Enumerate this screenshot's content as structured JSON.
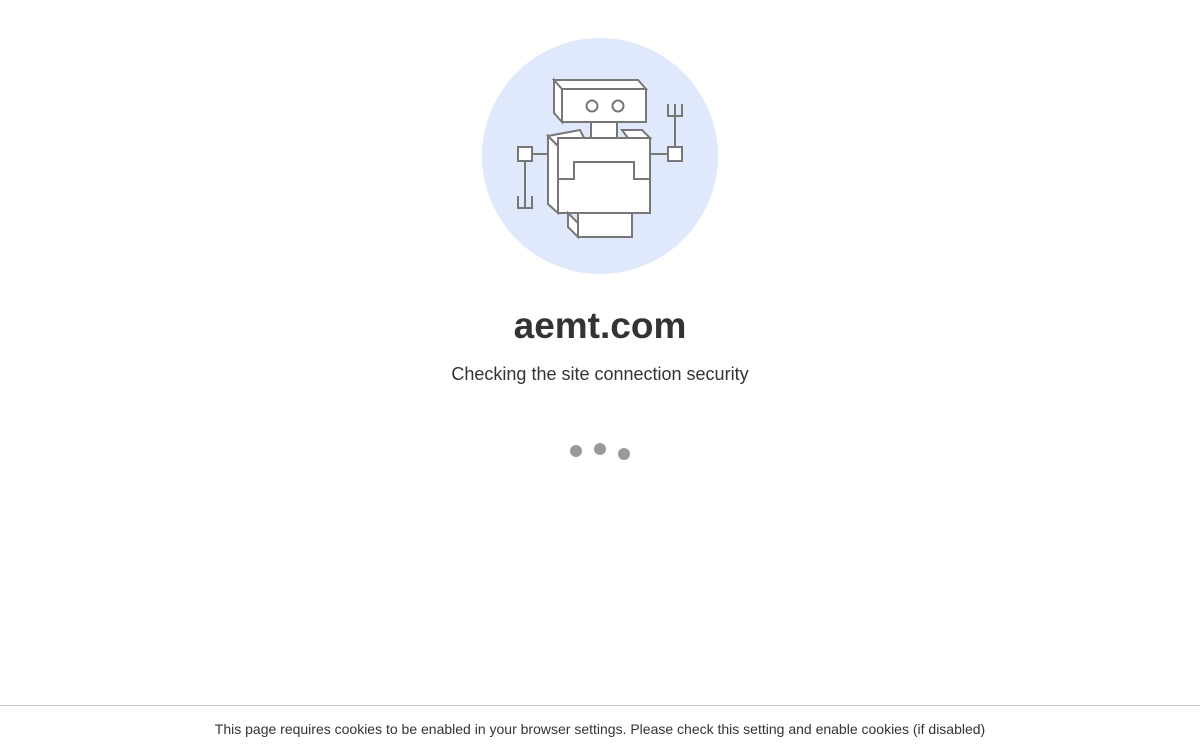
{
  "header": {
    "domain": "aemt.com",
    "status": "Checking the site connection security"
  },
  "illustration": {
    "icon": "robot-icon",
    "background_color": "#dfe9fb",
    "stroke_color": "#777777"
  },
  "loader": {
    "icon": "loading-dots-icon",
    "dot_color": "#9a9a9a"
  },
  "footer": {
    "notice": "This page requires cookies to be enabled in your browser settings. Please check this setting and enable cookies (if disabled)"
  }
}
